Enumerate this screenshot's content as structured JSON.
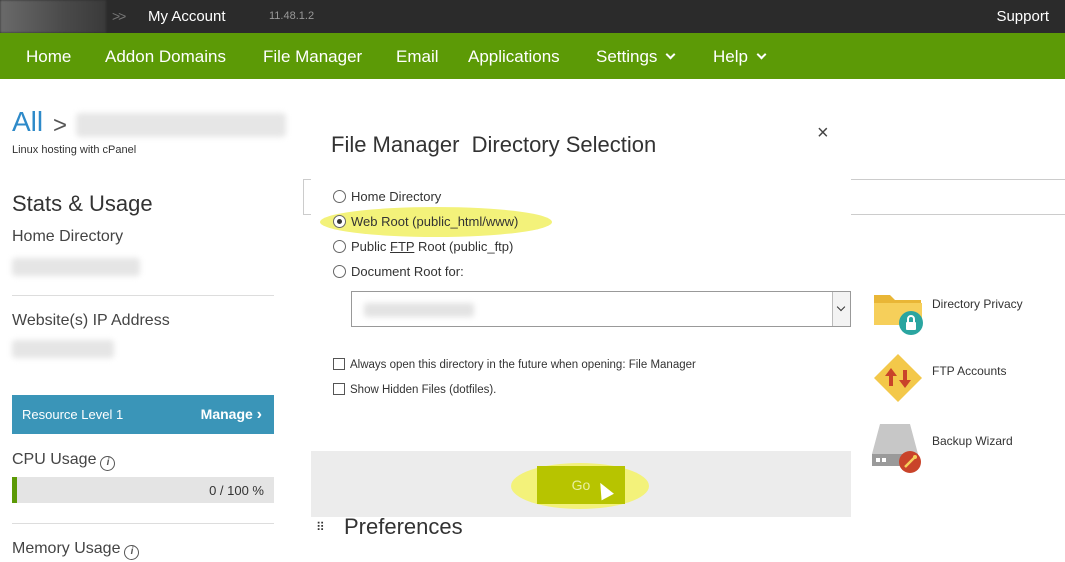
{
  "topbar": {
    "breadcrumb_chevron": ">>",
    "my_account": "My Account",
    "version": "11.48.1.2",
    "support": "Support"
  },
  "nav": {
    "items": [
      {
        "label": "Home"
      },
      {
        "label": "Addon Domains"
      },
      {
        "label": "File Manager"
      },
      {
        "label": "Email"
      },
      {
        "label": "Applications"
      },
      {
        "label": "Settings"
      },
      {
        "label": "Help"
      }
    ]
  },
  "left": {
    "all": "All",
    "all_chevron": ">",
    "hosting": "Linux hosting with cPanel",
    "stats_title": "Stats & Usage",
    "home_directory": "Home Directory",
    "ip_address": "Website(s) IP Address",
    "resource_level": "Resource Level 1",
    "manage": "Manage",
    "manage_chevron": "›",
    "cpu_usage": "CPU Usage",
    "cpu_value": "0 / 100 %",
    "cpu_progress": 0.02,
    "memory_usage": "Memory Usage",
    "info_glyph": "i"
  },
  "tools": [
    {
      "label": "Directory Privacy",
      "icon": "folder-lock-icon"
    },
    {
      "label": "FTP Accounts",
      "icon": "ftp-arrows-icon"
    },
    {
      "label": "Backup Wizard",
      "icon": "backup-drive-icon"
    }
  ],
  "preferences": {
    "handle": "⠿",
    "title": "Preferences"
  },
  "dialog": {
    "title": "File Manager  Directory Selection",
    "close": "×",
    "options": [
      {
        "label": "Home Directory",
        "checked": false
      },
      {
        "label": "Web Root (public_html/www)",
        "checked": true
      },
      {
        "label_prefix": "Public ",
        "label_underline": "FTP",
        "label_suffix": " Root (public_ftp)",
        "checked": false
      },
      {
        "label": "Document Root for:",
        "checked": false
      }
    ],
    "checkboxes": [
      {
        "label": "Always open this directory in the future when opening: File Manager",
        "checked": false
      },
      {
        "label": "Show Hidden Files (dotfiles).",
        "checked": false
      }
    ],
    "go": "Go"
  },
  "colors": {
    "nav_green": "#5c9a06",
    "resource_blue": "#3a95b8",
    "link_blue": "#2e8ac9",
    "go_button": "#b7c400",
    "highlight": "#f3f27a"
  }
}
